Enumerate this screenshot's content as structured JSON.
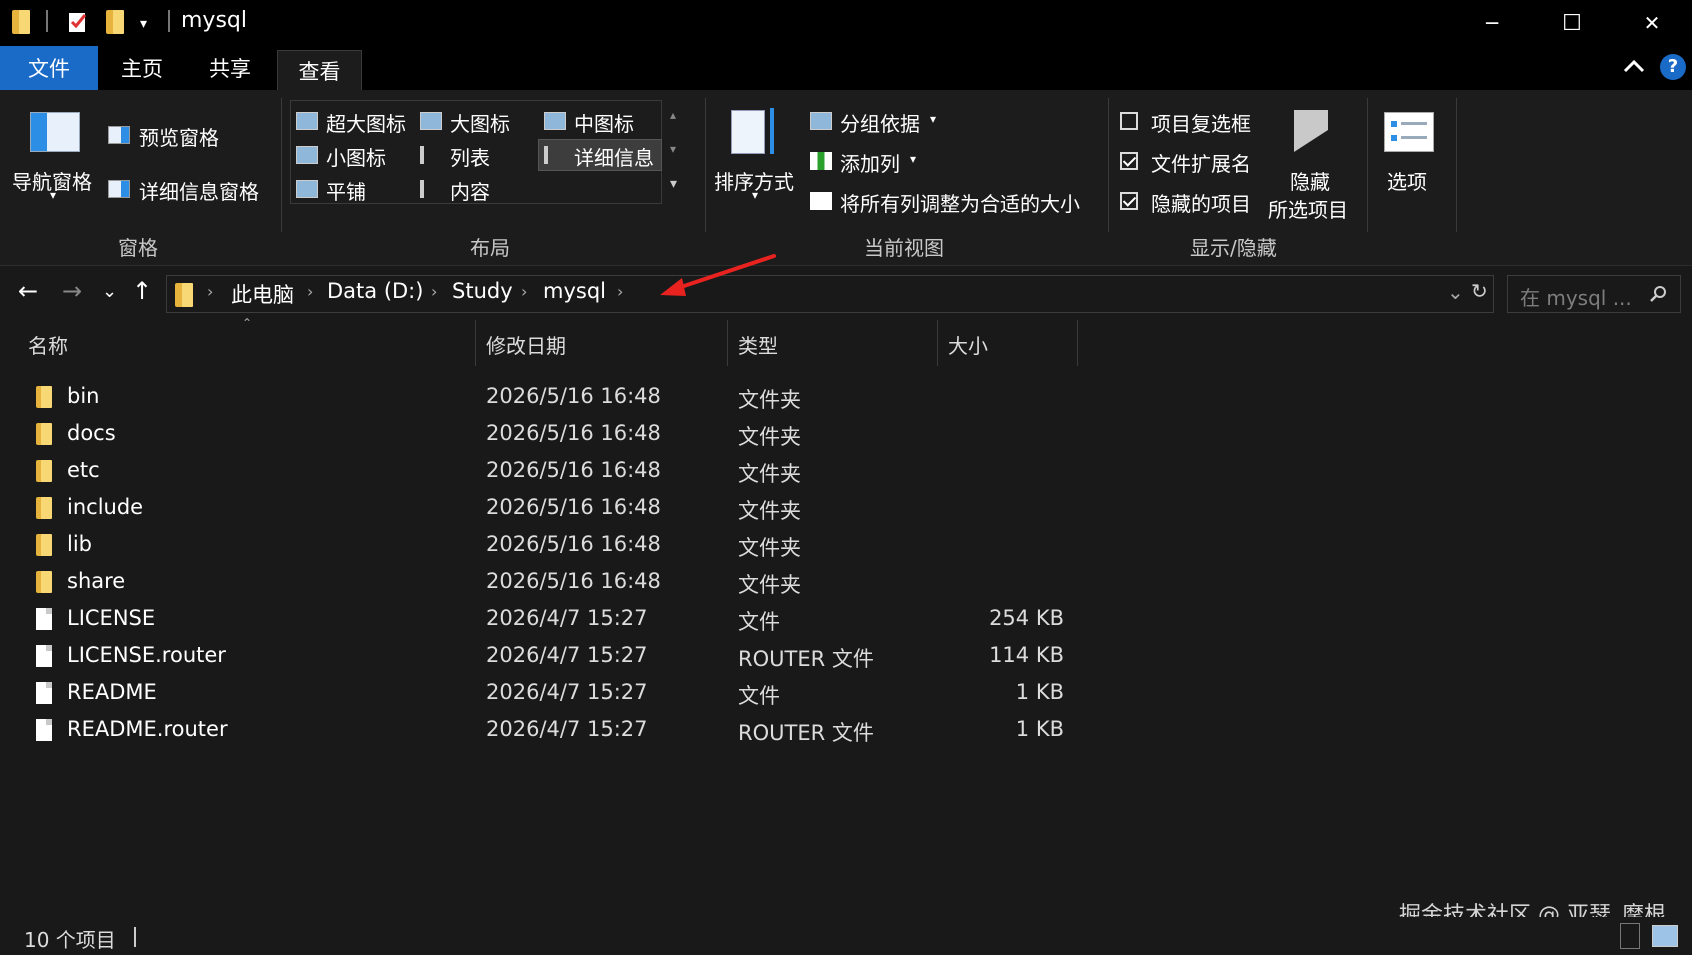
{
  "window": {
    "title": "mysql",
    "minimize": "─",
    "maximize": "☐",
    "close": "✕"
  },
  "tabs": {
    "file": "文件",
    "home": "主页",
    "share": "共享",
    "view": "查看",
    "help": "?"
  },
  "ribbon": {
    "panes": {
      "nav_pane": "导航窗格",
      "preview_pane": "预览窗格",
      "details_pane": "详细信息窗格",
      "group_label": "窗格"
    },
    "layout": {
      "extra_large_icons": "超大图标",
      "large_icons": "大图标",
      "medium_icons": "中图标",
      "small_icons": "小图标",
      "list": "列表",
      "details": "详细信息",
      "tiles": "平铺",
      "content": "内容",
      "group_label": "布局"
    },
    "current_view": {
      "sort_by": "排序方式",
      "group_by": "分组依据",
      "add_columns": "添加列",
      "size_all_columns": "将所有列调整为合适的大小",
      "group_label": "当前视图"
    },
    "show_hide": {
      "item_checkboxes": "项目复选框",
      "file_extensions": "文件扩展名",
      "hidden_items": "隐藏的项目",
      "hide_selected_line1": "隐藏",
      "hide_selected_line2": "所选项目",
      "group_label": "显示/隐藏",
      "item_checkboxes_checked": false,
      "file_extensions_checked": true,
      "hidden_items_checked": true
    },
    "options": "选项"
  },
  "address": {
    "crumbs": [
      "此电脑",
      "Data (D:)",
      "Study",
      "mysql"
    ],
    "search_placeholder": "在 mysql ..."
  },
  "columns": {
    "name": "名称",
    "date": "修改日期",
    "type": "类型",
    "size": "大小"
  },
  "files": [
    {
      "name": "bin",
      "date": "2026/5/16 16:48",
      "type": "文件夹",
      "size": "",
      "icon": "folder"
    },
    {
      "name": "docs",
      "date": "2026/5/16 16:48",
      "type": "文件夹",
      "size": "",
      "icon": "folder"
    },
    {
      "name": "etc",
      "date": "2026/5/16 16:48",
      "type": "文件夹",
      "size": "",
      "icon": "folder"
    },
    {
      "name": "include",
      "date": "2026/5/16 16:48",
      "type": "文件夹",
      "size": "",
      "icon": "folder"
    },
    {
      "name": "lib",
      "date": "2026/5/16 16:48",
      "type": "文件夹",
      "size": "",
      "icon": "folder"
    },
    {
      "name": "share",
      "date": "2026/5/16 16:48",
      "type": "文件夹",
      "size": "",
      "icon": "folder"
    },
    {
      "name": "LICENSE",
      "date": "2026/4/7 15:27",
      "type": "文件",
      "size": "254 KB",
      "icon": "file"
    },
    {
      "name": "LICENSE.router",
      "date": "2026/4/7 15:27",
      "type": "ROUTER 文件",
      "size": "114 KB",
      "icon": "file"
    },
    {
      "name": "README",
      "date": "2026/4/7 15:27",
      "type": "文件",
      "size": "1 KB",
      "icon": "file"
    },
    {
      "name": "README.router",
      "date": "2026/4/7 15:27",
      "type": "ROUTER 文件",
      "size": "1 KB",
      "icon": "file"
    }
  ],
  "status": {
    "count": "10 个项目"
  },
  "watermark": "掘金技术社区 @ 亚瑟_摩根",
  "colors": {
    "accent": "#1a6ac7",
    "arrow": "#e8231f",
    "folder": "#e6b43c"
  }
}
